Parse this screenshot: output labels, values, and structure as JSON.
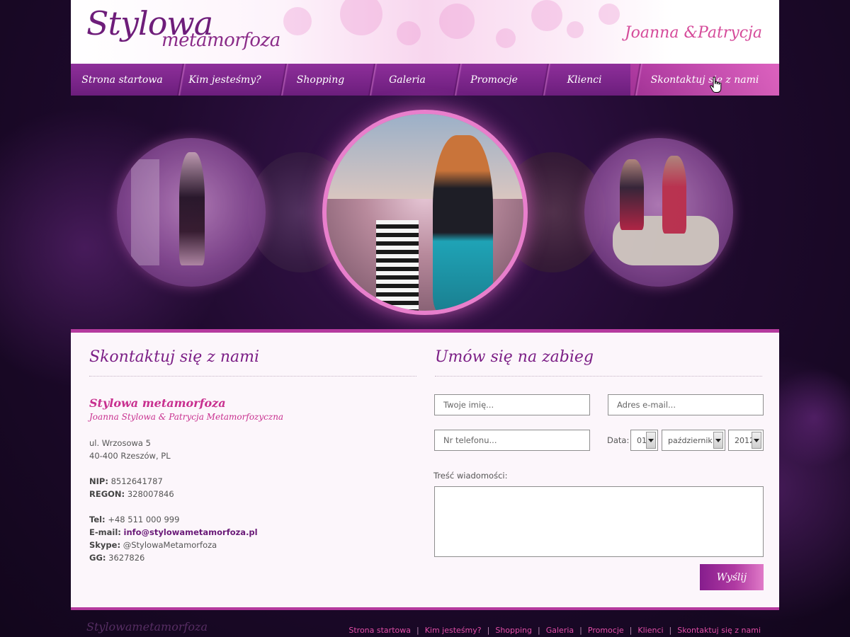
{
  "header": {
    "logo_line1": "Stylowa",
    "logo_line2": "metamorfoza",
    "authors": "Joanna &Patrycja"
  },
  "nav": {
    "items": [
      {
        "label": "Strona startowa"
      },
      {
        "label": "Kim jesteśmy?"
      },
      {
        "label": "Shopping"
      },
      {
        "label": "Galeria"
      },
      {
        "label": "Promocje"
      },
      {
        "label": "Klienci"
      },
      {
        "label": "Skontaktuj się z nami",
        "active": true
      }
    ]
  },
  "contact": {
    "title": "Skontaktuj się z nami",
    "brand_name": "Stylowa metamorfoza",
    "owners": "Joanna Stylowa & Patrycja Metamorfozyczna",
    "address_line1": "ul. Wrzosowa 5",
    "address_line2": "40-400 Rzeszów, PL",
    "nip_label": "NIP:",
    "nip_value": "8512641787",
    "regon_label": "REGON:",
    "regon_value": "328007846",
    "tel_label": "Tel:",
    "tel_value": "+48 511 000 999",
    "email_label": "E-mail:",
    "email_value": "info@stylowametamorfoza.pl",
    "skype_label": "Skype:",
    "skype_value": "@StylowaMetamorfoza",
    "gg_label": "GG:",
    "gg_value": "3627826"
  },
  "booking": {
    "title": "Umów się na zabieg",
    "name_placeholder": "Twoje imię...",
    "email_placeholder": "Adres e-mail...",
    "phone_placeholder": "Nr telefonu...",
    "date_label": "Data:",
    "day": "01",
    "month": "październik",
    "year": "2012",
    "message_label": "Treść wiadomości:",
    "send_label": "Wyślij"
  },
  "footer": {
    "logo_line1": "Stylowa",
    "logo_line2": "metamorfoza",
    "links": [
      "Strona startowa",
      "Kim jesteśmy?",
      "Shopping",
      "Galeria",
      "Promocje",
      "Klienci",
      "Skontaktuj się z nami"
    ]
  },
  "colors": {
    "brand_purple": "#7c1f86",
    "brand_pink": "#c8308f",
    "footer_link": "#e14ea7"
  }
}
